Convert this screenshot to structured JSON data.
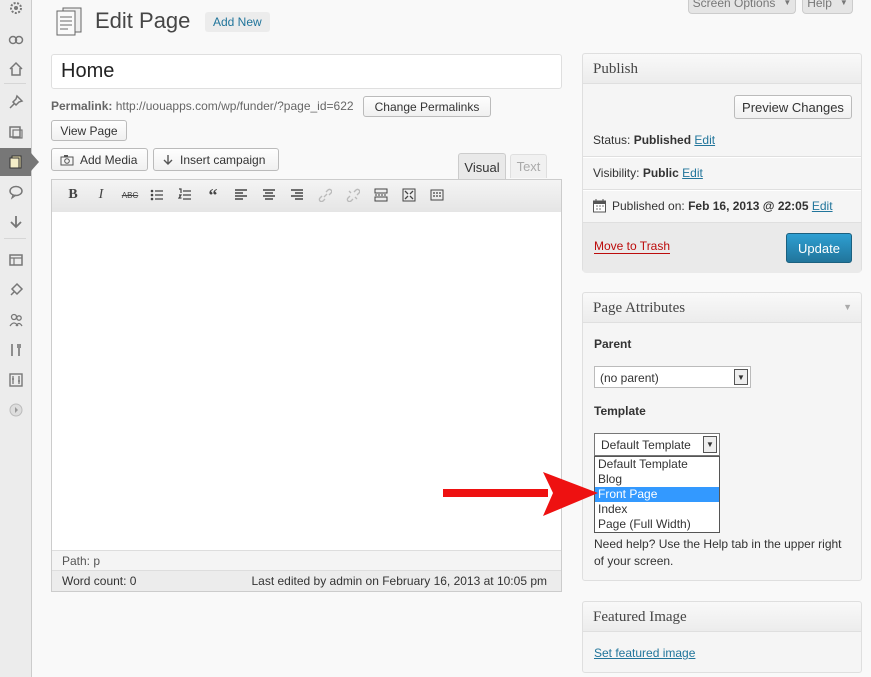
{
  "header": {
    "title": "Edit Page",
    "add_new": "Add New",
    "screen_options": "Screen Options",
    "help": "Help"
  },
  "editor": {
    "title_value": "Home",
    "permalink_label": "Permalink:",
    "permalink_url": "http://uouapps.com/wp/funder/?page_id=622",
    "change_permalinks": "Change Permalinks",
    "view_page": "View Page",
    "add_media": "Add Media",
    "insert_campaign": "Insert campaign",
    "tab_visual": "Visual",
    "tab_text": "Text",
    "path": "Path: p",
    "word_count": "Word count: 0",
    "last_edited": "Last edited by admin on February 16, 2013 at 10:05 pm"
  },
  "toolbar": [
    "bold-icon",
    "italic-icon",
    "strikethrough-icon",
    "bullet-list-icon",
    "numbered-list-icon",
    "blockquote-icon",
    "align-left-icon",
    "align-center-icon",
    "align-right-icon",
    "link-icon",
    "unlink-icon",
    "read-more-icon",
    "fullscreen-icon",
    "kitchen-sink-icon"
  ],
  "publish": {
    "title": "Publish",
    "preview": "Preview Changes",
    "status_label": "Status:",
    "status_value": "Published",
    "visibility_label": "Visibility:",
    "visibility_value": "Public",
    "published_label": "Published on:",
    "published_value": "Feb 16, 2013 @ 22:05",
    "edit": "Edit",
    "trash": "Move to Trash",
    "update": "Update"
  },
  "attributes": {
    "title": "Page Attributes",
    "parent_label": "Parent",
    "parent_value": "(no parent)",
    "template_label": "Template",
    "template_value": "Default Template",
    "template_options": [
      "Default Template",
      "Blog",
      "Front Page",
      "Index",
      "Page (Full Width)"
    ],
    "selected_option": "Front Page",
    "help_text_1": "Need help? Use the Help tab in the upper right",
    "help_text_2": "of your screen."
  },
  "featured": {
    "title": "Featured Image",
    "set_link": "Set featured image"
  },
  "colors": {
    "link": "#21759b",
    "update_button": "#2a8bbf",
    "trash": "#bc0b0b",
    "selected_option": "#3399ff",
    "arrow": "#ee1111"
  }
}
